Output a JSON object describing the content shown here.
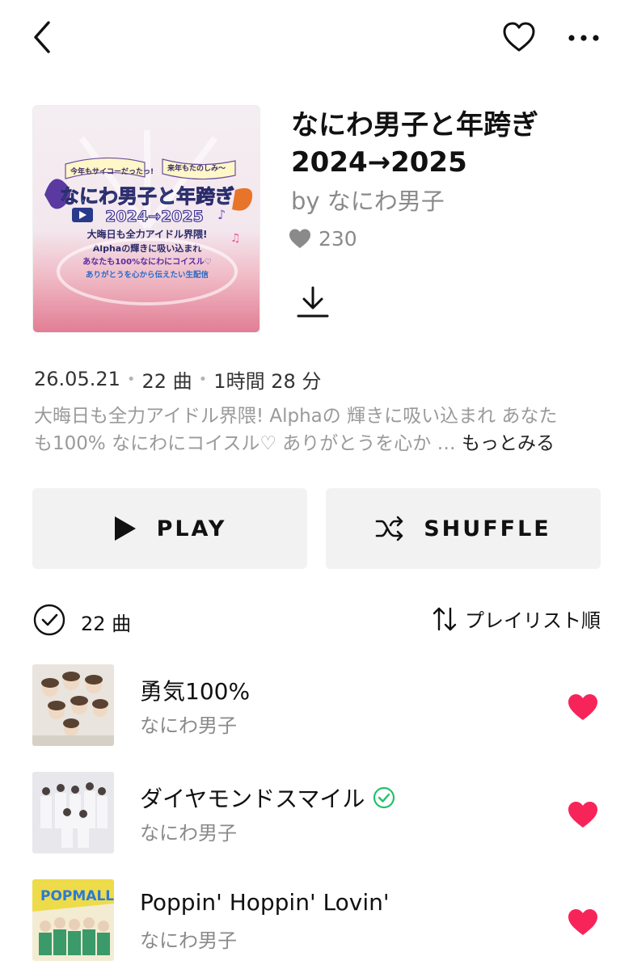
{
  "playlist": {
    "title_line1": "なにわ男子と年跨ぎ",
    "title_line2": "2024→2025",
    "byline": "by なにわ男子",
    "likes": "230",
    "date": "26.05.21",
    "track_count": "22 曲",
    "duration": "1時間 28 分",
    "description_line1": "大晦日も全力アイドル界隈! Alphaの 輝きに吸い込まれ あなた",
    "description_line2": "も100% なにわにコイスル♡ ありがとうを心か … ",
    "more_label": "もっとみる"
  },
  "cover_art": {
    "banner_left": "今年もサイコーだったっ!",
    "banner_right": "来年もたのしみ〜",
    "main": "なにわ男子と年跨ぎ",
    "years": "2024→2025",
    "sub1": "大晦日も全力アイドル界隈!",
    "sub2": "Alphaの輝きに吸い込まれ",
    "sub3": "あなたも100%なにわにコイスル♡",
    "sub4": "ありがとうを心から伝えたい生配信"
  },
  "actions": {
    "play_label": "PLAY",
    "shuffle_label": "SHUFFLE"
  },
  "list_header": {
    "count": "22 曲",
    "sort_label": "プレイリスト順"
  },
  "tracks": [
    {
      "title": "勇気100%",
      "artist": "なにわ男子",
      "liked": true,
      "verified": false
    },
    {
      "title": "ダイヤモンドスマイル",
      "artist": "なにわ男子",
      "liked": true,
      "verified": true
    },
    {
      "title": "Poppin' Hoppin' Lovin'",
      "artist": "なにわ男子",
      "liked": true,
      "verified": false
    }
  ],
  "colors": {
    "heart": "#f7245a",
    "verified": "#21c26b",
    "button_bg": "#f2f2f2",
    "muted_text": "#8a8a8a"
  },
  "icons": [
    "back-icon",
    "heart-outline-icon",
    "more-icon",
    "heart-filled-icon",
    "download-icon",
    "play-icon",
    "shuffle-icon",
    "check-circle-icon",
    "sort-icon",
    "verified-icon"
  ]
}
